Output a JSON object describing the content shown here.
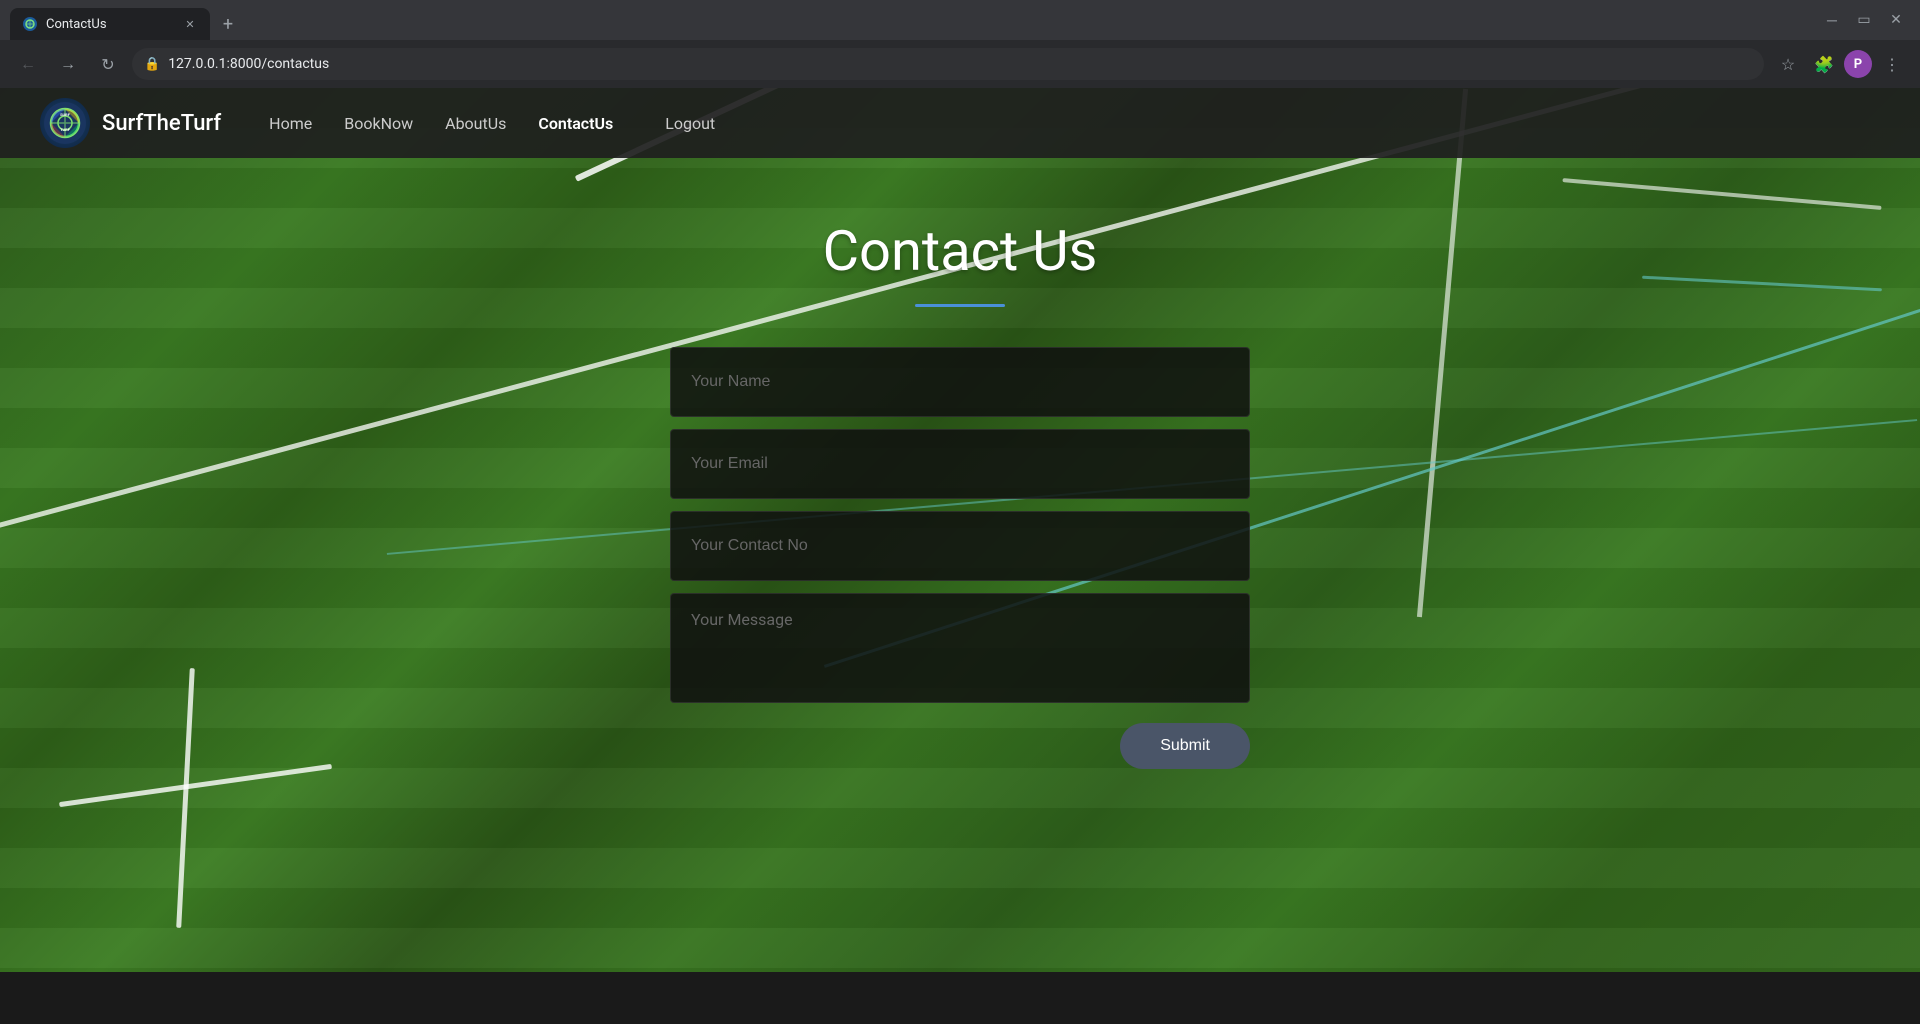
{
  "browser": {
    "tab_label": "ContactUs",
    "url": "127.0.0.1:8000/contactus",
    "profile_initial": "P"
  },
  "navbar": {
    "brand_name": "SurfTheTurf",
    "links": [
      {
        "label": "Home",
        "active": false
      },
      {
        "label": "BookNow",
        "active": false
      },
      {
        "label": "AboutUs",
        "active": false
      },
      {
        "label": "ContactUs",
        "active": true
      },
      {
        "label": "Logout",
        "active": false
      }
    ]
  },
  "page": {
    "title": "Contact Us",
    "underline_color": "#4a90d9"
  },
  "form": {
    "name_placeholder": "Your Name",
    "email_placeholder": "Your Email",
    "contact_placeholder": "Your Contact No",
    "message_placeholder": "Your Message",
    "submit_label": "Submit"
  }
}
